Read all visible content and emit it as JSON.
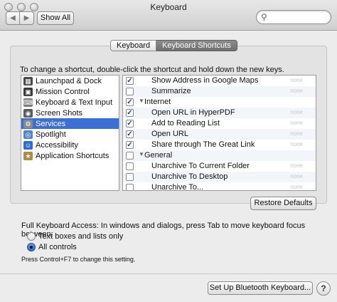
{
  "window": {
    "title": "Keyboard"
  },
  "toolbar": {
    "back_glyph": "◀",
    "forward_glyph": "▶",
    "show_all_label": "Show All",
    "search_placeholder": "",
    "search_icon": "magnifier-icon"
  },
  "tabs": [
    {
      "label": "Keyboard",
      "active": false
    },
    {
      "label": "Keyboard Shortcuts",
      "active": true
    }
  ],
  "instruction": "To change a shortcut, double-click the shortcut and hold down the new keys.",
  "categories": [
    {
      "label": "Launchpad & Dock",
      "icon": "launchpad-icon",
      "color": "#4a4a4a",
      "selected": false
    },
    {
      "label": "Mission Control",
      "icon": "mission-control-icon",
      "color": "#3a3a3a",
      "selected": false
    },
    {
      "label": "Keyboard & Text Input",
      "icon": "keyboard-icon",
      "color": "#7d7d7d",
      "selected": false
    },
    {
      "label": "Screen Shots",
      "icon": "camera-icon",
      "color": "#5a5a5a",
      "selected": false
    },
    {
      "label": "Services",
      "icon": "gear-icon",
      "color": "#8a8a8a",
      "selected": true
    },
    {
      "label": "Spotlight",
      "icon": "spotlight-icon",
      "color": "#4b86d6",
      "selected": false
    },
    {
      "label": "Accessibility",
      "icon": "accessibility-icon",
      "color": "#2f6ed0",
      "selected": false
    },
    {
      "label": "Application Shortcuts",
      "icon": "app-shortcuts-icon",
      "color": "#b08a40",
      "selected": false
    }
  ],
  "shortcuts": [
    {
      "label": "Show Address in Google Maps",
      "checked": true,
      "group": false,
      "key": "none"
    },
    {
      "label": "Summarize",
      "checked": false,
      "group": false,
      "key": "none"
    },
    {
      "label": "Internet",
      "checked": true,
      "group": true,
      "key": ""
    },
    {
      "label": "Open URL in HyperPDF",
      "checked": true,
      "group": false,
      "key": "none"
    },
    {
      "label": "Add to Reading List",
      "checked": true,
      "group": false,
      "key": "none"
    },
    {
      "label": "Open URL",
      "checked": true,
      "group": false,
      "key": "none"
    },
    {
      "label": "Share through The Great Link",
      "checked": true,
      "group": false,
      "key": "none"
    },
    {
      "label": "General",
      "checked": false,
      "group": true,
      "key": ""
    },
    {
      "label": "Unarchive To Current Folder",
      "checked": false,
      "group": false,
      "key": "none"
    },
    {
      "label": "Unarchive To Desktop",
      "checked": false,
      "group": false,
      "key": "none"
    },
    {
      "label": "Unarchive To...",
      "checked": false,
      "group": false,
      "key": "none"
    }
  ],
  "restore_defaults_label": "Restore Defaults",
  "full_keyboard_access": {
    "label": "Full Keyboard Access: In windows and dialogs, press Tab to move keyboard focus between:",
    "options": [
      {
        "label": "Text boxes and lists only",
        "selected": false
      },
      {
        "label": "All controls",
        "selected": true
      }
    ],
    "note": "Press Control+F7 to change this setting."
  },
  "bluetooth_button_label": "Set Up Bluetooth Keyboard...",
  "help_label": "?",
  "colors": {
    "selection": "#3b6fd4",
    "checkmark": "#1a3f9a"
  }
}
